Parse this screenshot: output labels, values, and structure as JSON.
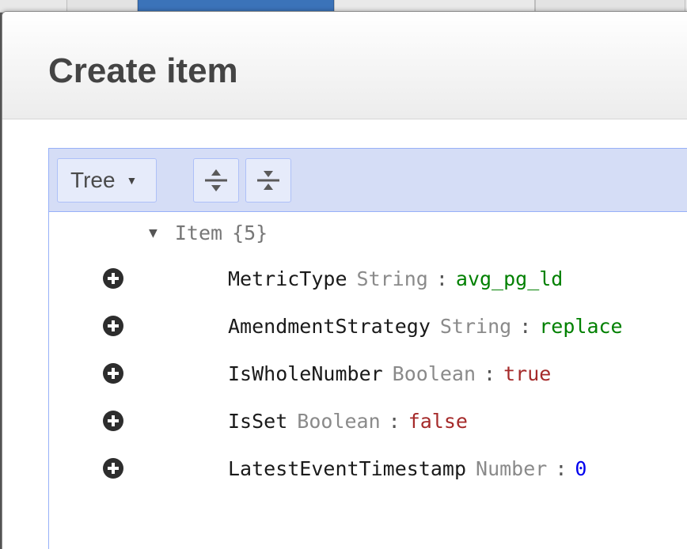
{
  "dialog": {
    "title": "Create item"
  },
  "editor": {
    "mode_label": "Tree",
    "mode_caret": "▼",
    "expand_all_icon": "expand-all-icon",
    "collapse_all_icon": "collapse-all-icon",
    "root": {
      "toggle": "▼",
      "name": "Item",
      "count": "{5}"
    },
    "fields": [
      {
        "name": "MetricType",
        "type": "String",
        "sep": ":",
        "value": "avg_pg_ld",
        "kind": "string"
      },
      {
        "name": "AmendmentStrategy",
        "type": "String",
        "sep": ":",
        "value": "replace",
        "kind": "string"
      },
      {
        "name": "IsWholeNumber",
        "type": "Boolean",
        "sep": ":",
        "value": "true",
        "kind": "boolean"
      },
      {
        "name": "IsSet",
        "type": "Boolean",
        "sep": ":",
        "value": "false",
        "kind": "boolean"
      },
      {
        "name": "LatestEventTimestamp",
        "type": "Number",
        "sep": ":",
        "value": "0",
        "kind": "number"
      }
    ]
  },
  "colors": {
    "editor_border": "#97b0f8",
    "menu_background": "#d5ddf6",
    "string_value": "#008000",
    "boolean_value": "#a52a2a",
    "number_value": "#0000ee"
  }
}
